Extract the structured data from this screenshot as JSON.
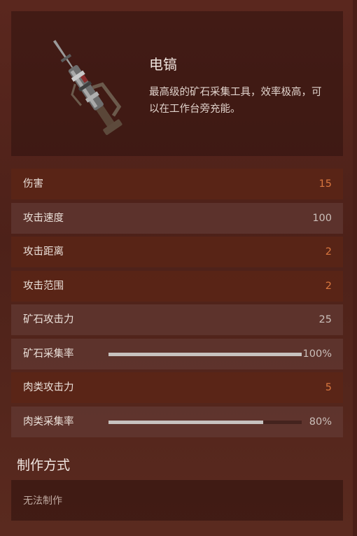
{
  "item": {
    "name": "电镐",
    "description": "最高级的矿石采集工具，效率极高，可以在工作台旁充能。",
    "icon": "electric-pickaxe-icon"
  },
  "stats": [
    {
      "label": "伤害",
      "value": "15",
      "style": "orange"
    },
    {
      "label": "攻击速度",
      "value": "100",
      "style": "grey"
    },
    {
      "label": "攻击距离",
      "value": "2",
      "style": "orange"
    },
    {
      "label": "攻击范围",
      "value": "2",
      "style": "orange"
    },
    {
      "label": "矿石攻击力",
      "value": "25",
      "style": "grey"
    },
    {
      "label": "矿石采集率",
      "value": "100%",
      "style": "grey",
      "bar_fraction": 1.0
    },
    {
      "label": "肉类攻击力",
      "value": "5",
      "style": "orange"
    },
    {
      "label": "肉类采集率",
      "value": "80%",
      "style": "grey",
      "bar_fraction": 0.8
    }
  ],
  "crafting": {
    "title": "制作方式",
    "text": "无法制作"
  },
  "colors": {
    "accent_orange": "#d9773f",
    "value_grey": "#cbbfba"
  }
}
